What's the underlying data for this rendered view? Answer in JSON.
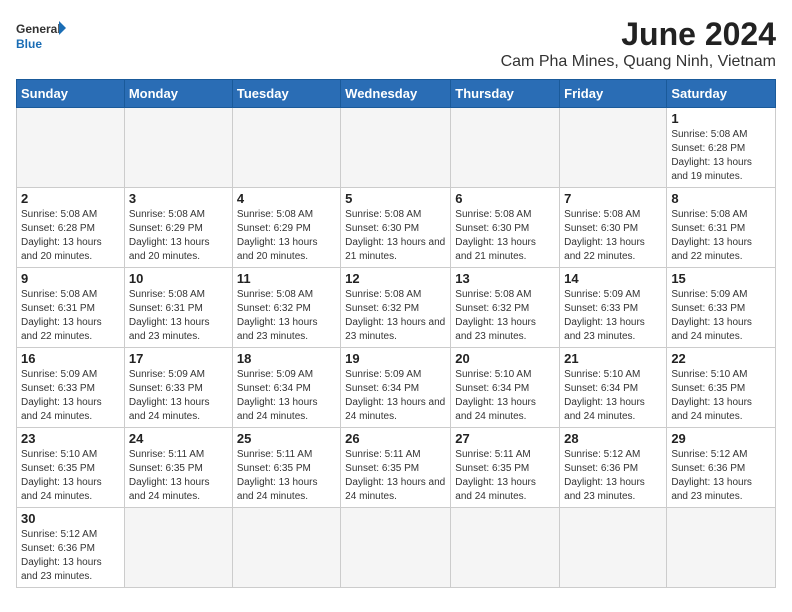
{
  "header": {
    "logo_general": "General",
    "logo_blue": "Blue",
    "month_year": "June 2024",
    "location": "Cam Pha Mines, Quang Ninh, Vietnam"
  },
  "days_of_week": [
    "Sunday",
    "Monday",
    "Tuesday",
    "Wednesday",
    "Thursday",
    "Friday",
    "Saturday"
  ],
  "weeks": [
    [
      {
        "day": "",
        "info": ""
      },
      {
        "day": "",
        "info": ""
      },
      {
        "day": "",
        "info": ""
      },
      {
        "day": "",
        "info": ""
      },
      {
        "day": "",
        "info": ""
      },
      {
        "day": "",
        "info": ""
      },
      {
        "day": "1",
        "info": "Sunrise: 5:08 AM\nSunset: 6:28 PM\nDaylight: 13 hours and 19 minutes."
      }
    ],
    [
      {
        "day": "2",
        "info": "Sunrise: 5:08 AM\nSunset: 6:28 PM\nDaylight: 13 hours and 20 minutes."
      },
      {
        "day": "3",
        "info": "Sunrise: 5:08 AM\nSunset: 6:29 PM\nDaylight: 13 hours and 20 minutes."
      },
      {
        "day": "4",
        "info": "Sunrise: 5:08 AM\nSunset: 6:29 PM\nDaylight: 13 hours and 20 minutes."
      },
      {
        "day": "5",
        "info": "Sunrise: 5:08 AM\nSunset: 6:30 PM\nDaylight: 13 hours and 21 minutes."
      },
      {
        "day": "6",
        "info": "Sunrise: 5:08 AM\nSunset: 6:30 PM\nDaylight: 13 hours and 21 minutes."
      },
      {
        "day": "7",
        "info": "Sunrise: 5:08 AM\nSunset: 6:30 PM\nDaylight: 13 hours and 22 minutes."
      },
      {
        "day": "8",
        "info": "Sunrise: 5:08 AM\nSunset: 6:31 PM\nDaylight: 13 hours and 22 minutes."
      }
    ],
    [
      {
        "day": "9",
        "info": "Sunrise: 5:08 AM\nSunset: 6:31 PM\nDaylight: 13 hours and 22 minutes."
      },
      {
        "day": "10",
        "info": "Sunrise: 5:08 AM\nSunset: 6:31 PM\nDaylight: 13 hours and 23 minutes."
      },
      {
        "day": "11",
        "info": "Sunrise: 5:08 AM\nSunset: 6:32 PM\nDaylight: 13 hours and 23 minutes."
      },
      {
        "day": "12",
        "info": "Sunrise: 5:08 AM\nSunset: 6:32 PM\nDaylight: 13 hours and 23 minutes."
      },
      {
        "day": "13",
        "info": "Sunrise: 5:08 AM\nSunset: 6:32 PM\nDaylight: 13 hours and 23 minutes."
      },
      {
        "day": "14",
        "info": "Sunrise: 5:09 AM\nSunset: 6:33 PM\nDaylight: 13 hours and 23 minutes."
      },
      {
        "day": "15",
        "info": "Sunrise: 5:09 AM\nSunset: 6:33 PM\nDaylight: 13 hours and 24 minutes."
      }
    ],
    [
      {
        "day": "16",
        "info": "Sunrise: 5:09 AM\nSunset: 6:33 PM\nDaylight: 13 hours and 24 minutes."
      },
      {
        "day": "17",
        "info": "Sunrise: 5:09 AM\nSunset: 6:33 PM\nDaylight: 13 hours and 24 minutes."
      },
      {
        "day": "18",
        "info": "Sunrise: 5:09 AM\nSunset: 6:34 PM\nDaylight: 13 hours and 24 minutes."
      },
      {
        "day": "19",
        "info": "Sunrise: 5:09 AM\nSunset: 6:34 PM\nDaylight: 13 hours and 24 minutes."
      },
      {
        "day": "20",
        "info": "Sunrise: 5:10 AM\nSunset: 6:34 PM\nDaylight: 13 hours and 24 minutes."
      },
      {
        "day": "21",
        "info": "Sunrise: 5:10 AM\nSunset: 6:34 PM\nDaylight: 13 hours and 24 minutes."
      },
      {
        "day": "22",
        "info": "Sunrise: 5:10 AM\nSunset: 6:35 PM\nDaylight: 13 hours and 24 minutes."
      }
    ],
    [
      {
        "day": "23",
        "info": "Sunrise: 5:10 AM\nSunset: 6:35 PM\nDaylight: 13 hours and 24 minutes."
      },
      {
        "day": "24",
        "info": "Sunrise: 5:11 AM\nSunset: 6:35 PM\nDaylight: 13 hours and 24 minutes."
      },
      {
        "day": "25",
        "info": "Sunrise: 5:11 AM\nSunset: 6:35 PM\nDaylight: 13 hours and 24 minutes."
      },
      {
        "day": "26",
        "info": "Sunrise: 5:11 AM\nSunset: 6:35 PM\nDaylight: 13 hours and 24 minutes."
      },
      {
        "day": "27",
        "info": "Sunrise: 5:11 AM\nSunset: 6:35 PM\nDaylight: 13 hours and 24 minutes."
      },
      {
        "day": "28",
        "info": "Sunrise: 5:12 AM\nSunset: 6:36 PM\nDaylight: 13 hours and 23 minutes."
      },
      {
        "day": "29",
        "info": "Sunrise: 5:12 AM\nSunset: 6:36 PM\nDaylight: 13 hours and 23 minutes."
      }
    ],
    [
      {
        "day": "30",
        "info": "Sunrise: 5:12 AM\nSunset: 6:36 PM\nDaylight: 13 hours and 23 minutes."
      },
      {
        "day": "",
        "info": ""
      },
      {
        "day": "",
        "info": ""
      },
      {
        "day": "",
        "info": ""
      },
      {
        "day": "",
        "info": ""
      },
      {
        "day": "",
        "info": ""
      },
      {
        "day": "",
        "info": ""
      }
    ]
  ]
}
